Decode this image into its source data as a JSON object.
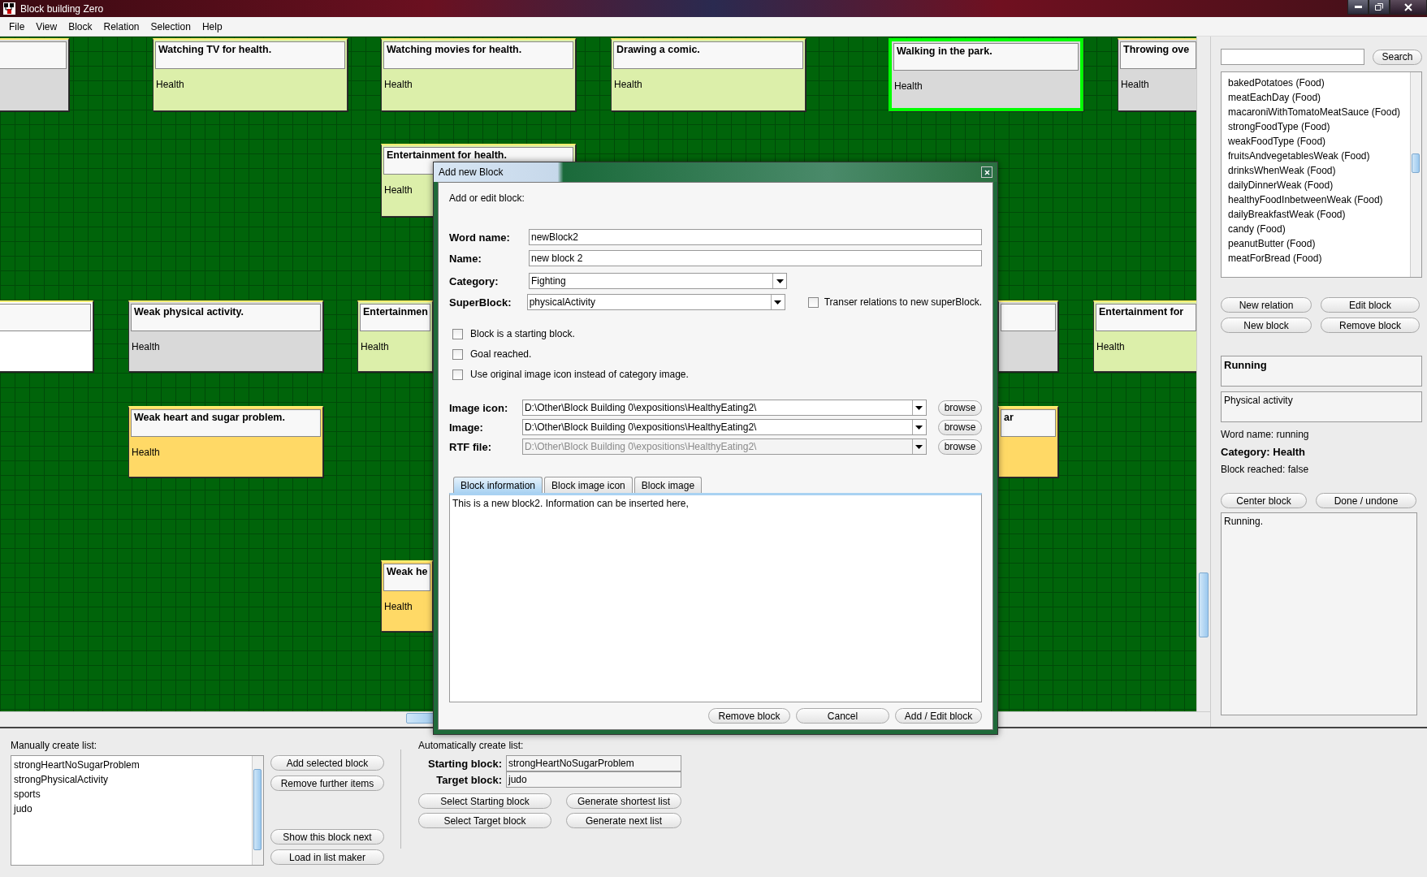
{
  "window": {
    "title": "Block building Zero"
  },
  "menu": [
    "File",
    "View",
    "Block",
    "Relation",
    "Selection",
    "Help"
  ],
  "canvas": {
    "blocks": [
      {
        "color": "#d9d9d9",
        "selected": false
      },
      {
        "title": "Watching TV for health.",
        "category": "Health",
        "color": "#dcefaa",
        "selected": false
      },
      {
        "title": "Watching movies for health.",
        "category": "Health",
        "color": "#dcefaa",
        "selected": false
      },
      {
        "title": "Drawing a comic.",
        "category": "Health",
        "color": "#dcefaa",
        "selected": false
      },
      {
        "title": "Walking in the park.",
        "category": "Health",
        "color": "#d9d9d9",
        "selected": true
      },
      {
        "title": "Throwing ove",
        "category": "Health",
        "color": "#d9d9d9",
        "selected": false
      },
      {
        "title": "Entertainment for health.",
        "category": "Health",
        "color": "#dcefaa",
        "selected": false
      },
      {
        "color": "#ffffff",
        "selected": false
      },
      {
        "title": "Weak physical activity.",
        "category": "Health",
        "color": "#d9d9d9",
        "selected": false
      },
      {
        "title": "Entertainmen",
        "category": "Health",
        "color": "#dcefaa",
        "selected": false
      },
      {
        "color": "#d9d9d9",
        "selected": false
      },
      {
        "title": "Entertainment for",
        "category": "Health",
        "color": "#dcefaa",
        "selected": false
      },
      {
        "title": "Weak heart and sugar problem.",
        "category": "Health",
        "color": "#ffd966",
        "selected": false
      },
      {
        "title": "ar",
        "color": "#ffd966",
        "selected": false
      },
      {
        "title": "Weak he",
        "category": "Health",
        "color": "#ffd966",
        "selected": false
      }
    ]
  },
  "dialog": {
    "title": "Add new Block",
    "heading": "Add or edit block:",
    "fields": [
      {
        "kind": "text",
        "label": "Word name:",
        "value": "newBlock2"
      },
      {
        "kind": "text",
        "label": "Name:",
        "value": "new block 2"
      },
      {
        "kind": "combo",
        "label": "Category:",
        "value": "Fighting"
      },
      {
        "kind": "combo",
        "label": "SuperBlock:",
        "value": "physicalActivity",
        "option": {
          "label": "Transer relations to new superBlock.",
          "checked": false
        }
      }
    ],
    "checkboxes": [
      {
        "label": "Block is a starting block.",
        "checked": false
      },
      {
        "label": "Goal reached.",
        "checked": false
      },
      {
        "label": "Use original image icon instead of category image.",
        "checked": false
      }
    ],
    "files": [
      {
        "label": "Image icon:",
        "value": "D:\\Other\\Block Building 0\\expositions\\HealthyEating2\\",
        "disabled": false,
        "button": "browse"
      },
      {
        "label": "Image:",
        "value": "D:\\Other\\Block Building 0\\expositions\\HealthyEating2\\",
        "disabled": false,
        "button": "browse"
      },
      {
        "label": "RTF file:",
        "value": "D:\\Other\\Block Building 0\\expositions\\HealthyEating2\\",
        "disabled": true,
        "button": "browse"
      }
    ],
    "tabs": [
      {
        "label": "Block information",
        "selected": true
      },
      {
        "label": "Block image icon",
        "selected": false
      },
      {
        "label": "Block image",
        "selected": false
      }
    ],
    "information": "This is a new block2. Information can be inserted here,",
    "buttons": [
      "Remove block",
      "Cancel",
      "Add / Edit block"
    ]
  },
  "sidebar": {
    "search_button": "Search",
    "items": [
      "bakedPotatoes (Food)",
      "meatEachDay (Food)",
      "macaroniWithTomatoMeatSauce (Food)",
      "strongFoodType (Food)",
      "weakFoodType (Food)",
      "fruitsAndvegetablesWeak (Food)",
      "drinksWhenWeak (Food)",
      "dailyDinnerWeak (Food)",
      "healthyFoodInbetweenWeak (Food)",
      "dailyBreakfastWeak (Food)",
      "candy (Food)",
      "peanutButter (Food)",
      "meatForBread (Food)"
    ],
    "buttons": [
      "New relation",
      "Edit block",
      "New block",
      "Remove block"
    ],
    "block_title": "Running",
    "block_category_box": "Physical activity",
    "word_name": "Word name: running",
    "category": "Category: Health",
    "reached": "Block reached: false",
    "buttons_2": [
      "Center block",
      "Done / undone"
    ],
    "description": "Running."
  },
  "bottom": {
    "manual": {
      "heading": "Manually create list:",
      "items": [
        "strongHeartNoSugarProblem",
        "strongPhysicalActivity",
        "sports",
        "judo"
      ],
      "buttons": [
        "Add selected block",
        "Remove further items",
        "Show this block next",
        "Load in list maker"
      ]
    },
    "automatic": {
      "heading": "Automatically create list:",
      "starting_label": "Starting block:",
      "starting_value": "strongHeartNoSugarProblem",
      "target_label": "Target block:",
      "target_value": "judo",
      "buttons": [
        "Select Starting block",
        "Generate shortest list",
        "Select Target block",
        "Generate next list"
      ]
    }
  }
}
